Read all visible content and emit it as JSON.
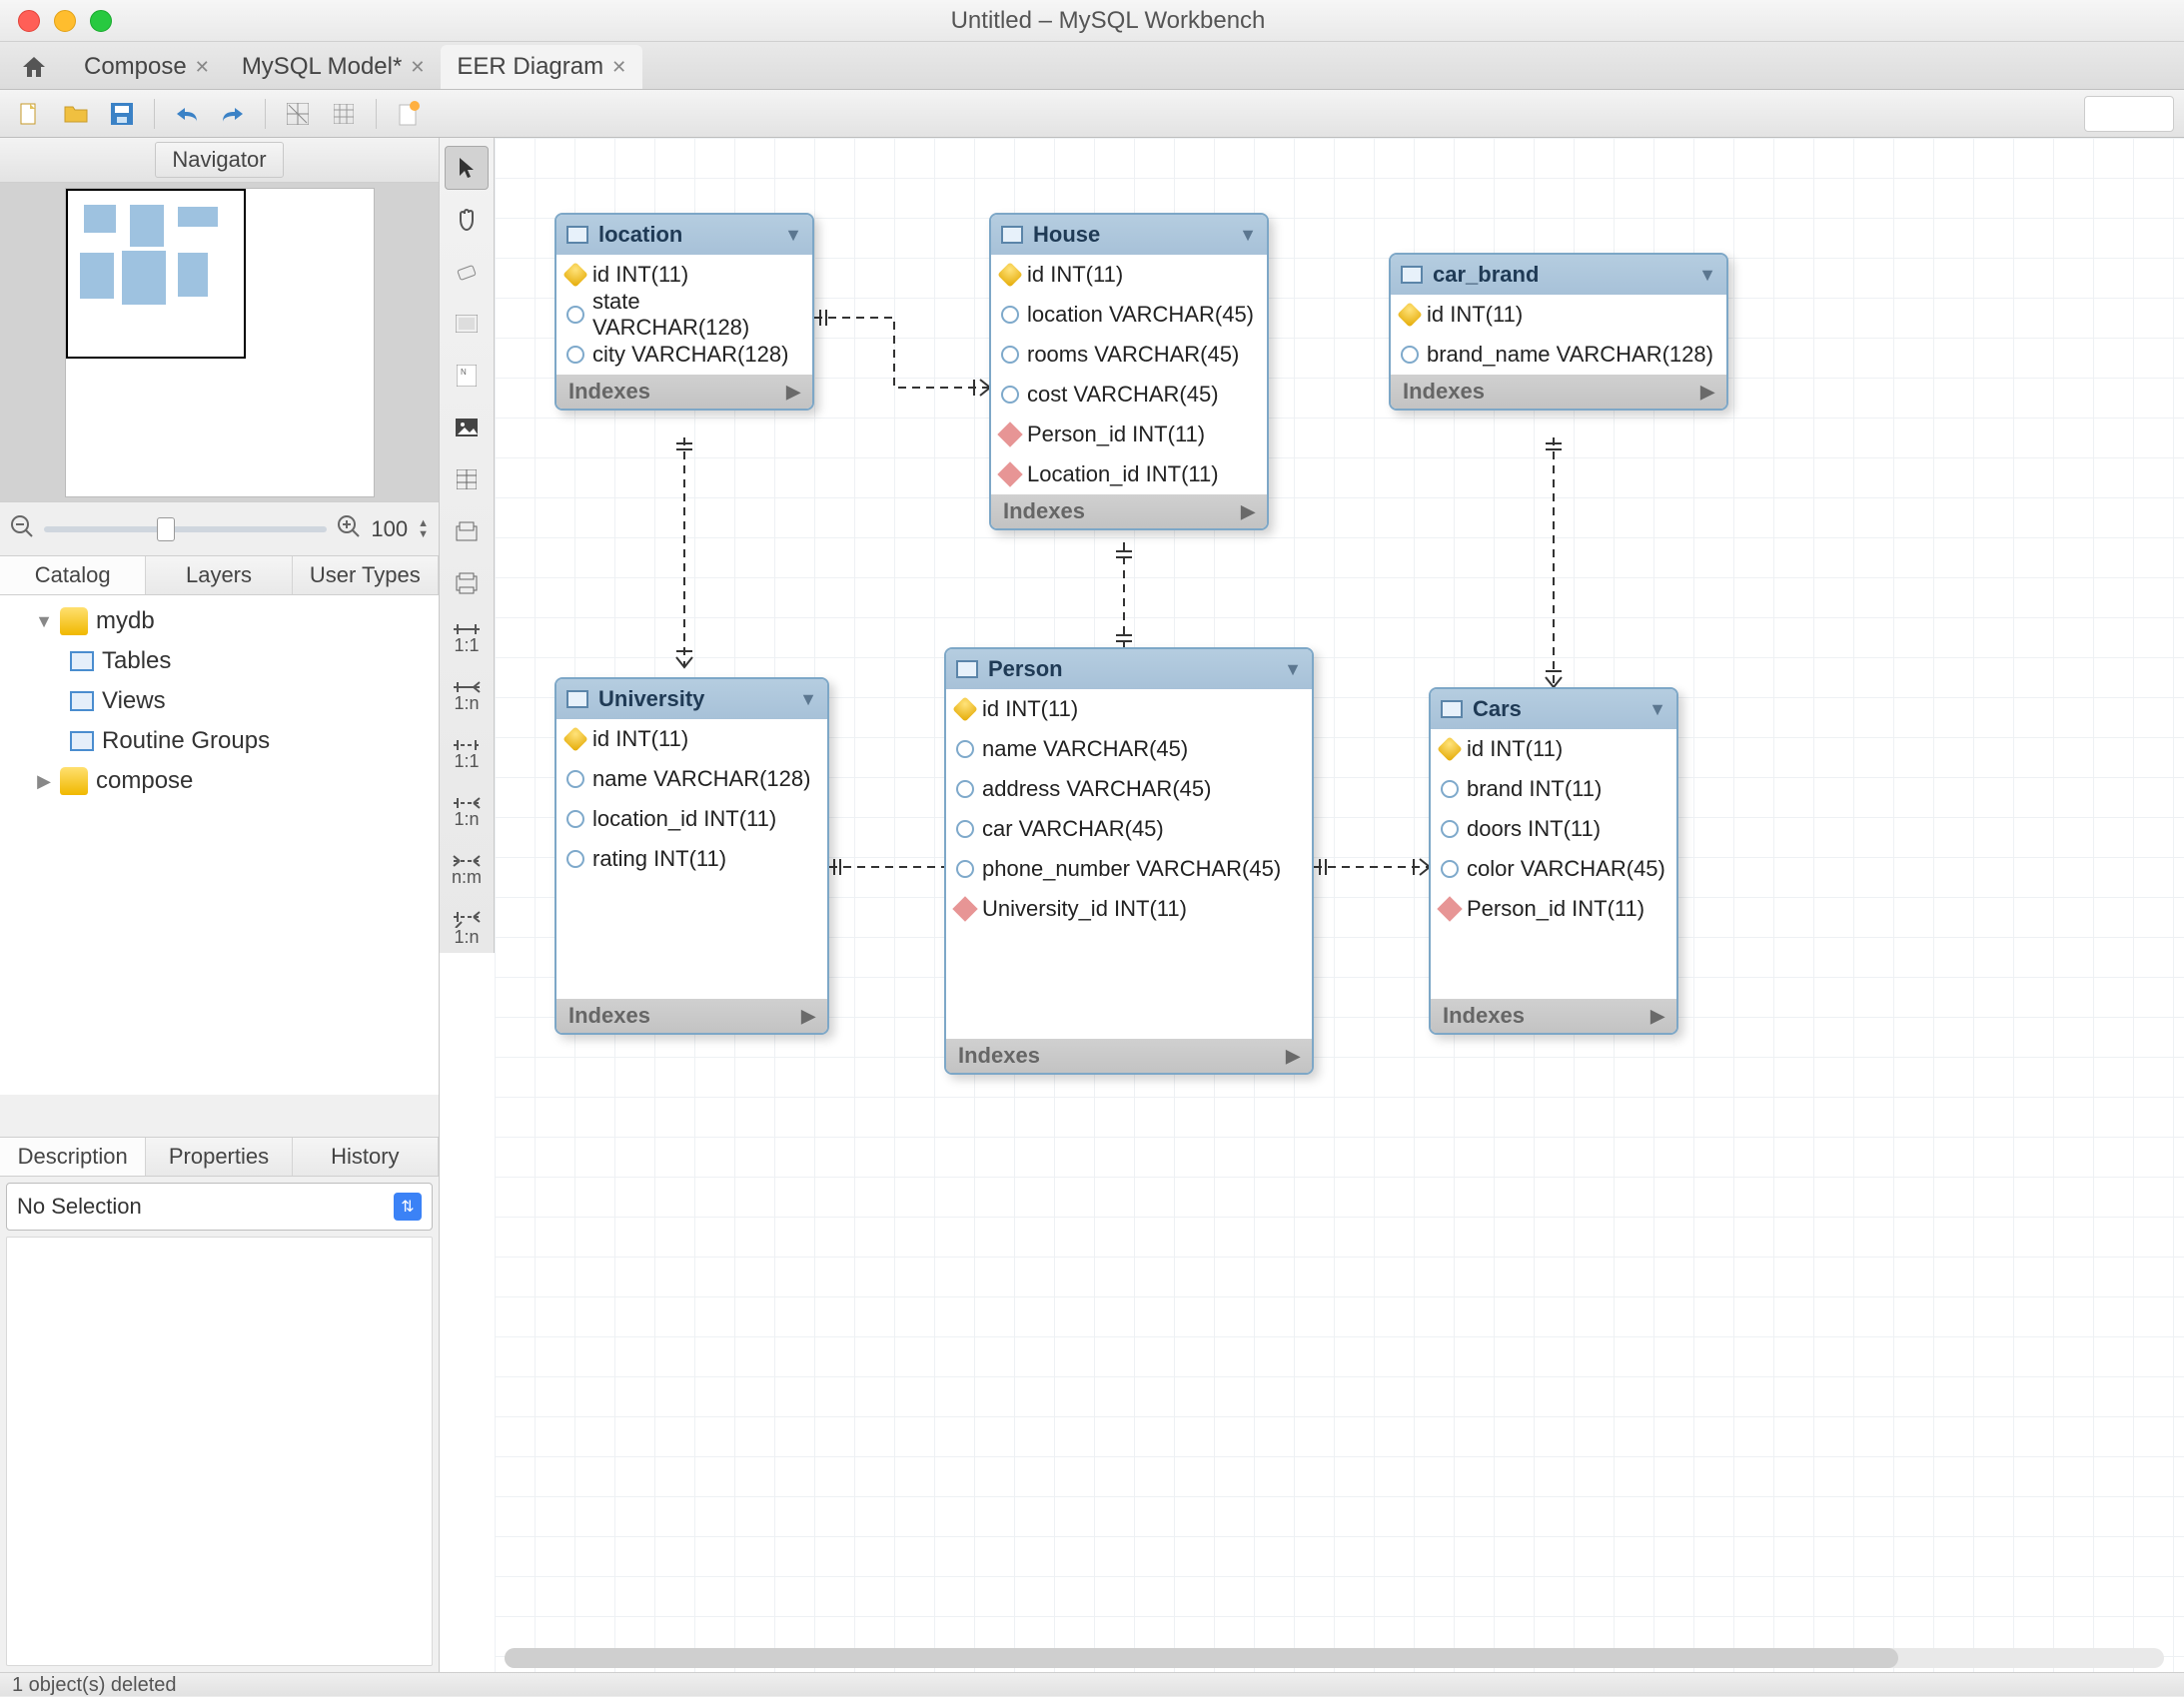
{
  "window": {
    "title": "Untitled – MySQL Workbench"
  },
  "tabs": {
    "items": [
      {
        "label": "Compose",
        "closable": true,
        "active": false
      },
      {
        "label": "MySQL Model*",
        "closable": true,
        "active": false
      },
      {
        "label": "EER Diagram",
        "closable": true,
        "active": true
      }
    ]
  },
  "navigator": {
    "title": "Navigator"
  },
  "zoom": {
    "value": "100"
  },
  "sidetabs": {
    "catalog": "Catalog",
    "layers": "Layers",
    "usertypes": "User Types"
  },
  "tree": {
    "db1": {
      "name": "mydb",
      "tables": "Tables",
      "views": "Views",
      "routines": "Routine Groups"
    },
    "db2": {
      "name": "compose"
    }
  },
  "bottomtabs": {
    "description": "Description",
    "properties": "Properties",
    "history": "History"
  },
  "selection": {
    "text": "No Selection"
  },
  "indexes_label": "Indexes",
  "entities": {
    "location": {
      "title": "location",
      "cols": [
        {
          "kind": "pk",
          "text": "id INT(11)"
        },
        {
          "kind": "att",
          "text": "state VARCHAR(128)"
        },
        {
          "kind": "att",
          "text": "city VARCHAR(128)"
        }
      ]
    },
    "house": {
      "title": "House",
      "cols": [
        {
          "kind": "pk",
          "text": "id INT(11)"
        },
        {
          "kind": "att",
          "text": "location VARCHAR(45)"
        },
        {
          "kind": "att",
          "text": "rooms VARCHAR(45)"
        },
        {
          "kind": "att",
          "text": "cost VARCHAR(45)"
        },
        {
          "kind": "fk",
          "text": "Person_id INT(11)"
        },
        {
          "kind": "fk",
          "text": "Location_id INT(11)"
        }
      ]
    },
    "car_brand": {
      "title": "car_brand",
      "cols": [
        {
          "kind": "pk",
          "text": "id INT(11)"
        },
        {
          "kind": "att",
          "text": "brand_name VARCHAR(128)"
        }
      ]
    },
    "university": {
      "title": "University",
      "cols": [
        {
          "kind": "pk",
          "text": "id INT(11)"
        },
        {
          "kind": "att",
          "text": "name VARCHAR(128)"
        },
        {
          "kind": "att",
          "text": "location_id INT(11)"
        },
        {
          "kind": "att",
          "text": "rating INT(11)"
        }
      ]
    },
    "person": {
      "title": "Person",
      "cols": [
        {
          "kind": "pk",
          "text": "id INT(11)"
        },
        {
          "kind": "att",
          "text": "name VARCHAR(45)"
        },
        {
          "kind": "att",
          "text": "address VARCHAR(45)"
        },
        {
          "kind": "att",
          "text": "car VARCHAR(45)"
        },
        {
          "kind": "att",
          "text": "phone_number VARCHAR(45)"
        },
        {
          "kind": "fk",
          "text": "University_id INT(11)"
        }
      ]
    },
    "cars": {
      "title": "Cars",
      "cols": [
        {
          "kind": "pk",
          "text": "id INT(11)"
        },
        {
          "kind": "att",
          "text": "brand INT(11)"
        },
        {
          "kind": "att",
          "text": "doors INT(11)"
        },
        {
          "kind": "att",
          "text": "color VARCHAR(45)"
        },
        {
          "kind": "fk",
          "text": "Person_id INT(11)"
        }
      ]
    }
  },
  "vtoolbar": {
    "rel11i": "1:1",
    "rel1ni": "1:n",
    "rel11": "1:1",
    "rel1n": "1:n",
    "relnm": "n:m",
    "rel1nfk": "1:n"
  },
  "status": {
    "text": "1 object(s) deleted"
  }
}
